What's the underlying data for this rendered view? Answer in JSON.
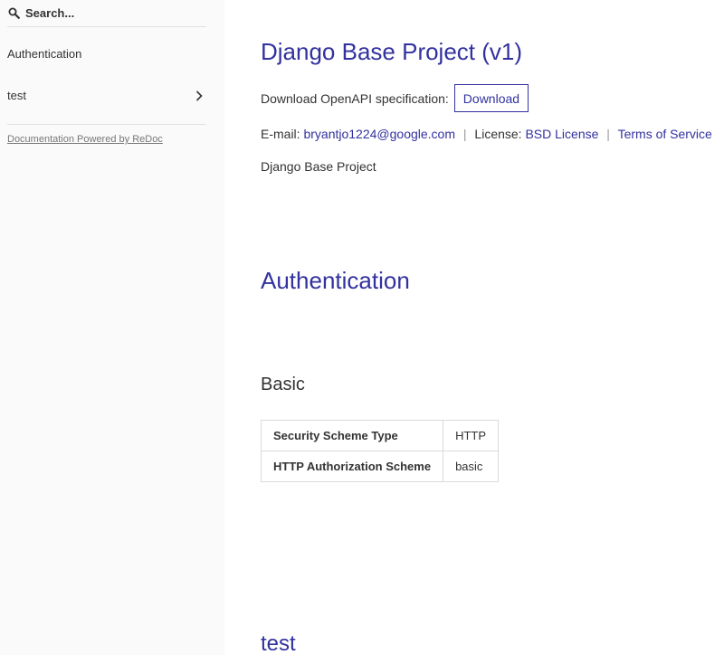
{
  "sidebar": {
    "search_placeholder": "Search...",
    "items": [
      {
        "label": "Authentication"
      },
      {
        "label": "test"
      }
    ],
    "powered_by": "Documentation Powered by ReDoc"
  },
  "main": {
    "title": "Django Base Project (v1)",
    "download_text": "Download OpenAPI specification:",
    "download_label": "Download",
    "email_label": "E-mail:",
    "email": "bryantjo1224@google.com",
    "license_label": "License:",
    "license": "BSD License",
    "terms": "Terms of Service",
    "description": "Django Base Project",
    "auth_heading": "Authentication",
    "basic_heading": "Basic",
    "scheme_table": [
      {
        "key": "Security Scheme Type",
        "value": "HTTP"
      },
      {
        "key": "HTTP Authorization Scheme",
        "value": "basic"
      }
    ],
    "test_heading": "test"
  },
  "colors": {
    "accent": "#32329f",
    "sidebar_bg": "#fafafa",
    "text": "#333333"
  }
}
